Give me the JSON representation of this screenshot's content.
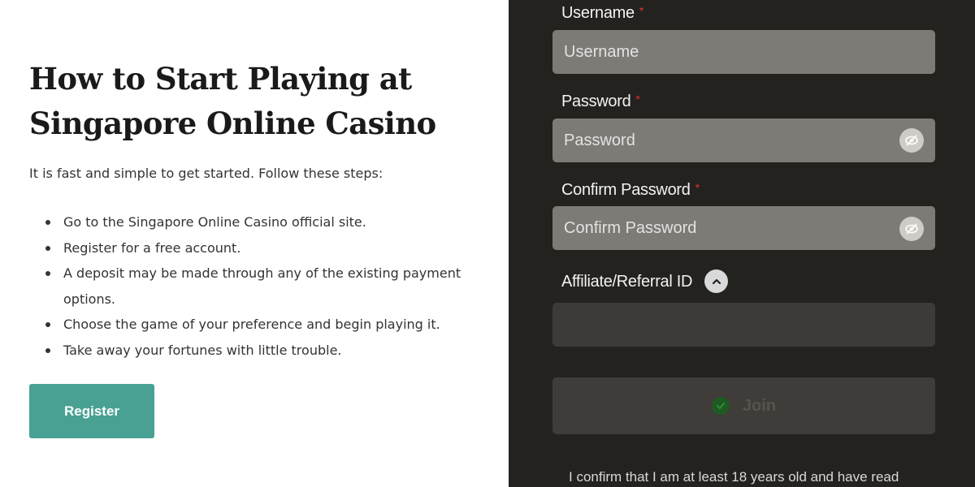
{
  "article": {
    "title_line1": "How to Start Playing at",
    "title_line2": "Singapore Online Casino",
    "intro": "It is fast and simple to get started. Follow these steps:",
    "steps": [
      "Go to the Singapore Online Casino official site.",
      "Register for a free account.",
      "A deposit may be made through any of the existing payment options.",
      "Choose the game of your preference and begin playing it.",
      "Take away your fortunes with little trouble."
    ],
    "register_label": "Register"
  },
  "form": {
    "username": {
      "label": "Username",
      "required_mark": "*",
      "placeholder": "Username"
    },
    "password": {
      "label": "Password",
      "required_mark": "*",
      "placeholder": "Password"
    },
    "confirm_password": {
      "label": "Confirm Password",
      "required_mark": "*",
      "placeholder": "Confirm Password"
    },
    "affiliate": {
      "label": "Affiliate/Referral ID"
    },
    "join_label": "Join",
    "confirm_text": "I confirm that I am at least 18 years old and have read"
  },
  "icons": {
    "password_toggle": "eye-slash-icon",
    "affiliate_toggle": "chevron-up-icon",
    "join_status": "check-circle-icon"
  },
  "colors": {
    "accent": "#48a192",
    "required": "#e0322b",
    "panel_bg": "#24221f",
    "field_bg": "#7e7a75",
    "join_check": "#1f5a22"
  }
}
